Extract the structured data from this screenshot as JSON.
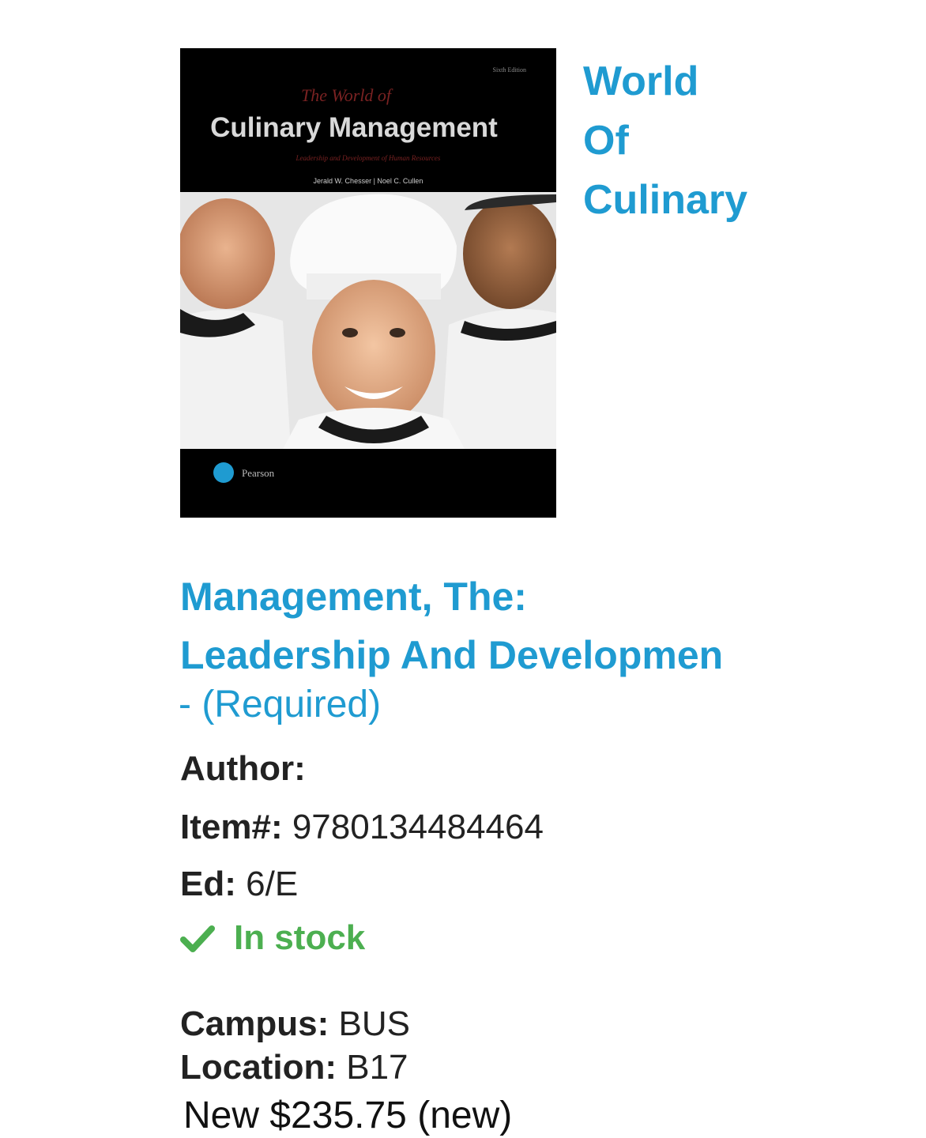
{
  "cover": {
    "edition_tag": "Sixth Edition",
    "series_line": "The World of",
    "main_title": "Culinary Management",
    "subtitle": "Leadership and Development of Human Resources",
    "authors": "Jerald W. Chesser | Noel C. Cullen",
    "publisher": "Pearson"
  },
  "side_title": {
    "line1": "World",
    "line2": "Of",
    "line3": "Culinary"
  },
  "title": {
    "line1": "Management, The:",
    "line2": "Leadership And Developmen"
  },
  "required_label": "- (Required)",
  "author": {
    "label": "Author:",
    "value": ""
  },
  "item": {
    "label": "Item#:",
    "value": "9780134484464"
  },
  "edition": {
    "label": "Ed:",
    "value": "6/E"
  },
  "stock": {
    "label": "In stock",
    "icon": "check-icon",
    "color": "#4caf50"
  },
  "campus": {
    "label": "Campus:",
    "value": "BUS"
  },
  "location": {
    "label": "Location:",
    "value": "B17"
  },
  "price": {
    "text": "New $235.75 (new)"
  },
  "colors": {
    "accent": "#1f9bd1",
    "stock": "#4caf50"
  }
}
